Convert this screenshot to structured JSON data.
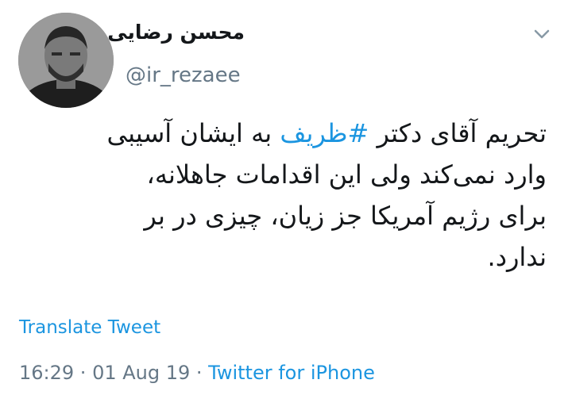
{
  "user": {
    "display_name": "محسن رضایی",
    "handle": "@ir_rezaee"
  },
  "tweet": {
    "line1_before": "تحریم آقای دکتر ",
    "hashtag": "#ظریف",
    "line1_after": " به ایشان آسیبی",
    "line2": "وارد نمی‌کند ولی این اقدامات جاهلانه،",
    "line3": "برای رژیم آمریکا جز زیان، چیزی در بر",
    "line4": "ندارد."
  },
  "translate_label": "Translate Tweet",
  "meta": {
    "time": "16:29",
    "separator": " · ",
    "date": "01 Aug 19",
    "source": "Twitter for iPhone"
  },
  "colors": {
    "link": "#1b95e0",
    "muted": "#657786",
    "text": "#14171a"
  },
  "icons": {
    "avatar": "user-avatar-photo",
    "menu": "chevron-down-icon"
  }
}
